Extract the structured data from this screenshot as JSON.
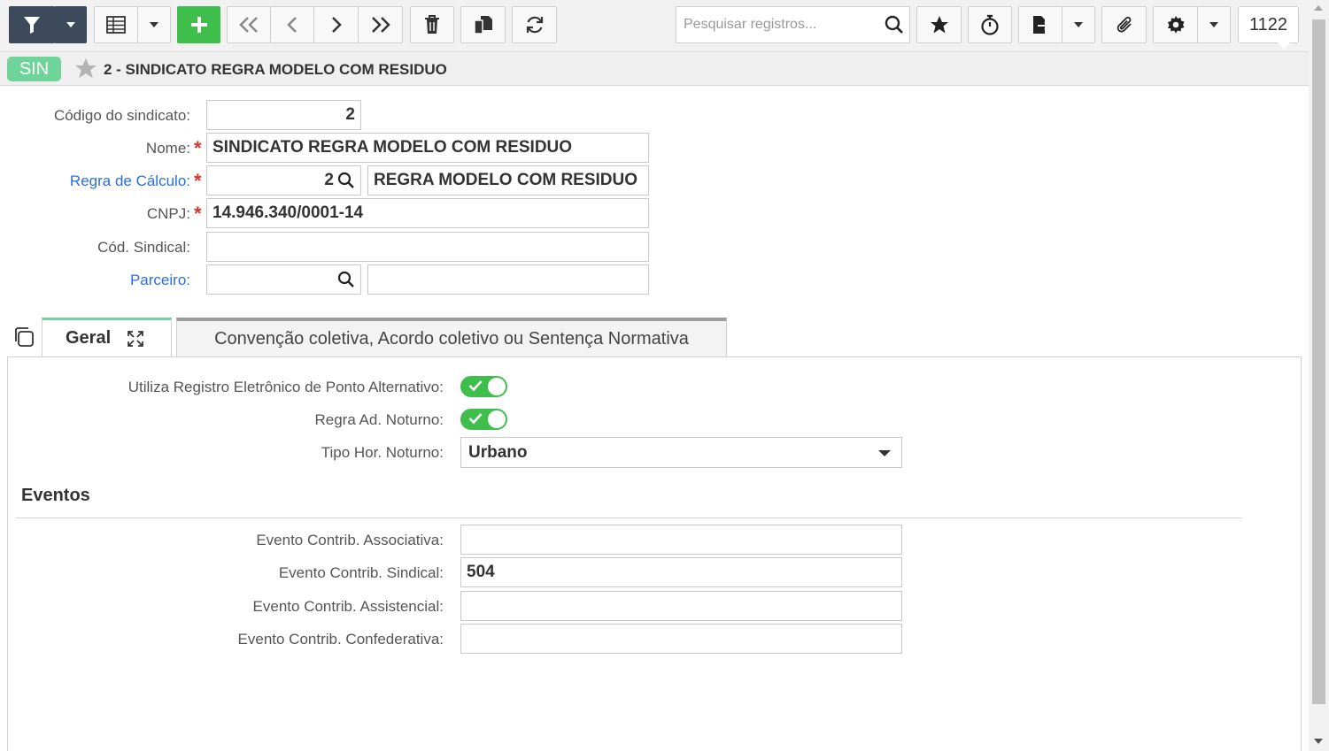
{
  "toolbar": {
    "filter_icon": "filter-icon",
    "grid_icon": "grid-icon",
    "add_icon": "plus-icon",
    "search_placeholder": "Pesquisar registros...",
    "record_count": "1122"
  },
  "header": {
    "badge": "SIN",
    "title": "2 - SINDICATO REGRA MODELO COM RESIDUO"
  },
  "form": {
    "codigo_label": "Código do sindicato:",
    "codigo_value": "2",
    "nome_label": "Nome:",
    "nome_value": "SINDICATO REGRA MODELO COM RESIDUO",
    "regra_label": "Regra de Cálculo:",
    "regra_code": "2",
    "regra_desc": "REGRA MODELO COM RESIDUO",
    "cnpj_label": "CNPJ:",
    "cnpj_value": "14.946.340/0001-14",
    "cod_sindical_label": "Cód. Sindical:",
    "cod_sindical_value": "",
    "parceiro_label": "Parceiro:",
    "parceiro_code": "",
    "parceiro_desc": "",
    "required_mark": "*"
  },
  "tabs": [
    {
      "label": "Geral",
      "active": true
    },
    {
      "label": "Convenção coletiva, Acordo coletivo ou Sentença Normativa",
      "active": false
    }
  ],
  "geral": {
    "rep_alt_label": "Utiliza Registro Eletrônico de Ponto Alternativo:",
    "rep_alt_on": true,
    "regra_noturno_label": "Regra Ad. Noturno:",
    "regra_noturno_on": true,
    "tipo_hor_label": "Tipo Hor. Noturno:",
    "tipo_hor_value": "Urbano",
    "eventos_title": "Eventos",
    "ev_assoc_label": "Evento Contrib. Associativa:",
    "ev_assoc_value": "",
    "ev_sindical_label": "Evento Contrib. Sindical:",
    "ev_sindical_value": "504",
    "ev_assist_label": "Evento Contrib. Assistencial:",
    "ev_assist_value": "",
    "ev_confed_label": "Evento Contrib. Confederativa:",
    "ev_confed_value": ""
  },
  "colors": {
    "accent_green": "#3fbe4b",
    "badge_green": "#6fd49a",
    "link_blue": "#2a6ee0",
    "required_red": "#d9362b",
    "dark_button": "#3d4a5c"
  }
}
